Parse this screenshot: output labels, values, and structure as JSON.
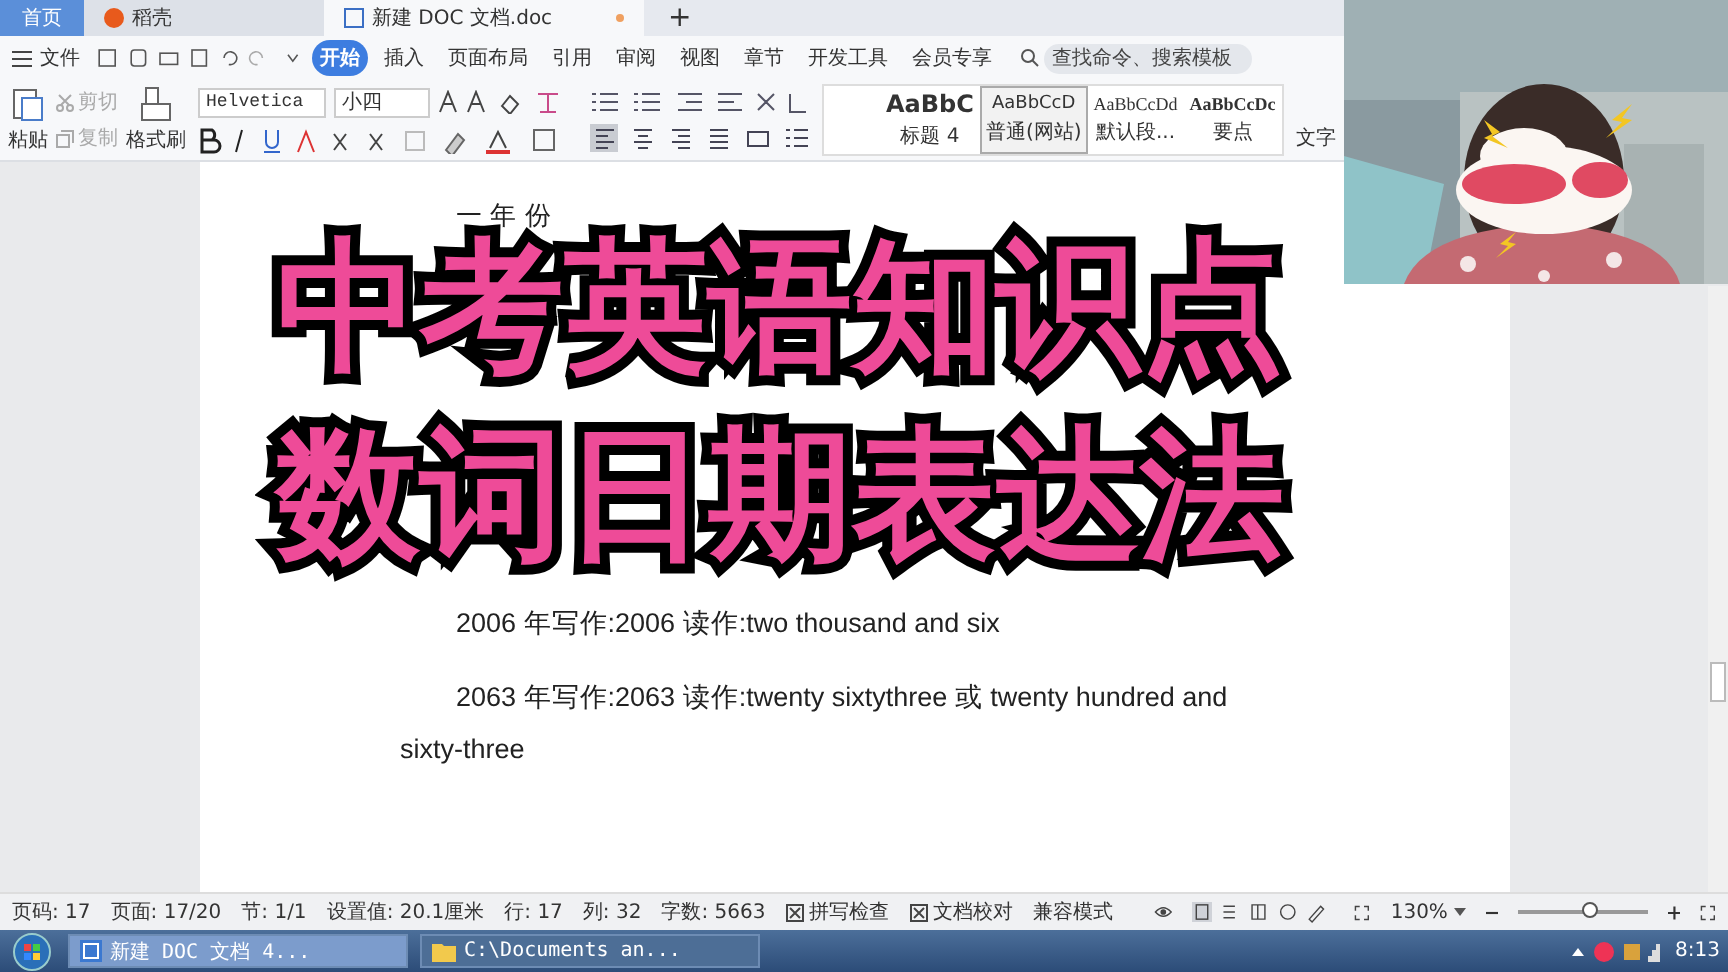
{
  "window_tabs": [
    {
      "label": "首页",
      "kind": "home",
      "selected": false
    },
    {
      "label": "稻壳",
      "kind": "app",
      "selected": false
    },
    {
      "label": "新建 DOC 文档.doc",
      "kind": "doc",
      "selected": true
    }
  ],
  "new_tab": "+",
  "menu": {
    "file": "文件",
    "tabs": [
      {
        "label": "开始",
        "selected": true
      },
      {
        "label": "插入",
        "selected": false
      },
      {
        "label": "页面布局",
        "selected": false
      },
      {
        "label": "引用",
        "selected": false
      },
      {
        "label": "审阅",
        "selected": false
      },
      {
        "label": "视图",
        "selected": false
      },
      {
        "label": "章节",
        "selected": false
      },
      {
        "label": "开发工具",
        "selected": false
      },
      {
        "label": "会员专享",
        "selected": false
      }
    ],
    "search": {
      "placeholder": "查找命令、搜索模板"
    }
  },
  "clipboard": {
    "paste": "粘贴",
    "cut": "剪切",
    "copy": "复制",
    "painter": "格式刷"
  },
  "font": {
    "name": "Helvetica",
    "size": "小四"
  },
  "styles": [
    {
      "preview": "AaBbC",
      "label": "标题 4",
      "kind": "heading",
      "selected": false
    },
    {
      "preview": "AaBbCcD",
      "label": "普通(网站)",
      "kind": "normal",
      "selected": true
    },
    {
      "preview": "AaBbCcDd",
      "label": "默认段...",
      "kind": "serif",
      "selected": false
    },
    {
      "preview": "AaBbCcDc",
      "label": "要点",
      "kind": "bold",
      "selected": false
    }
  ],
  "layout_label": "文字",
  "document": {
    "heading": "一 年 份",
    "paragraphs": [
      "2006 年写作:2006 读作:two thousand and six",
      "2063 年写作:2063 读作:twenty sixtythree 或 twenty hundred and sixty-three"
    ]
  },
  "overlay_title": {
    "lines": [
      "中考英语知识点",
      "数词日期表达法"
    ]
  },
  "status_bar": {
    "items": [
      "页码: 17",
      "页面: 17/20",
      "节: 1/1",
      "设置值: 20.1厘米",
      "行: 17",
      "列: 32",
      "字数: 5663"
    ],
    "buttons": [
      "拼写检查",
      "文档校对"
    ],
    "mode": "兼容模式",
    "zoom": "130%",
    "zoom_slider": {
      "level": 0.55
    }
  },
  "taskbar": {
    "items": [
      {
        "label": "新建 DOC 文档 4...",
        "kind": "doc",
        "selected": true
      },
      {
        "label": "C:\\Documents an...",
        "kind": "folder",
        "selected": false
      }
    ],
    "clock": "8:13"
  }
}
